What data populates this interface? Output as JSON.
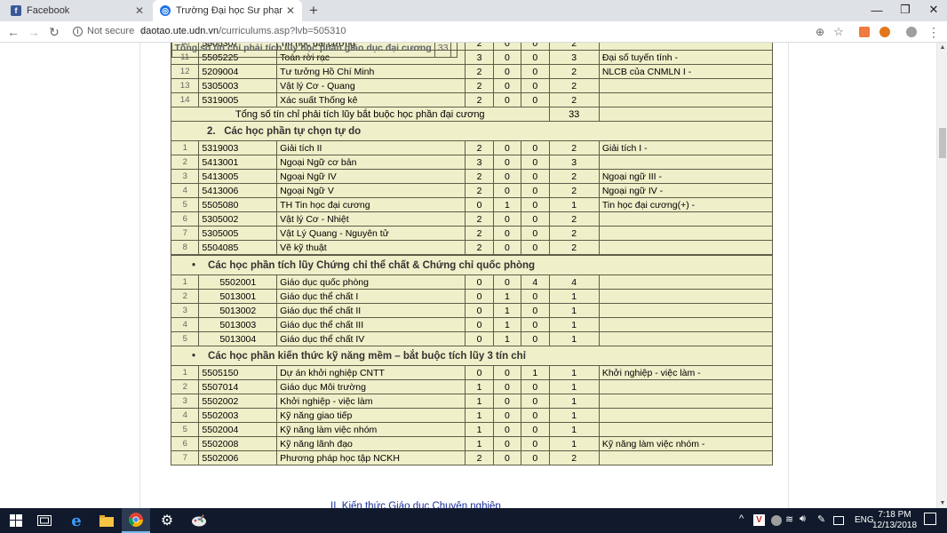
{
  "browser": {
    "tabs": [
      {
        "title": "Facebook",
        "active": false,
        "favicon": "facebook-icon",
        "color": "#3b5998"
      },
      {
        "title": "Trường Đại học Sư phạm Kỹ thuật",
        "active": true,
        "favicon": "globe-icon",
        "color": "#1a73e8"
      }
    ],
    "new_tab": "+",
    "security_label": "Not secure",
    "url_host": "daotao.ute.udn.vn",
    "url_path": "/curriculums.asp?lvb=505310",
    "window_controls": {
      "minimize": "—",
      "restore": "❐",
      "close": "✕"
    }
  },
  "page": {
    "table": {
      "group1": {
        "rows": [
          {
            "no": "11",
            "code": "5505225",
            "name": "Toán rời rạc",
            "c1": "3",
            "c2": "0",
            "c3": "0",
            "credits": "3",
            "prereq": "Đại số tuyến tính -"
          },
          {
            "no": "12",
            "code": "5209004",
            "name": "Tư tưởng Hồ Chí Minh",
            "c1": "2",
            "c2": "0",
            "c3": "0",
            "credits": "2",
            "prereq": "NLCB của CNMLN I -"
          },
          {
            "no": "13",
            "code": "5305003",
            "name": "Vật lý Cơ - Quang",
            "c1": "2",
            "c2": "0",
            "c3": "0",
            "credits": "2",
            "prereq": ""
          },
          {
            "no": "14",
            "code": "5319005",
            "name": "Xác suất Thống kê",
            "c1": "2",
            "c2": "0",
            "c3": "0",
            "credits": "2",
            "prereq": ""
          }
        ],
        "total_label": "Tổng số tín chỉ phải tích lũy bắt buộc học phần đại cương",
        "total_value": "33"
      },
      "group2": {
        "heading_num": "2.",
        "heading": "Các học phần tự chọn tự do",
        "rows": [
          {
            "no": "1",
            "code": "5319003",
            "name": "Giải tích II",
            "c1": "2",
            "c2": "0",
            "c3": "0",
            "credits": "2",
            "prereq": "Giải tích I -"
          },
          {
            "no": "2",
            "code": "5413001",
            "name": "Ngoại Ngữ cơ bản",
            "c1": "3",
            "c2": "0",
            "c3": "0",
            "credits": "3",
            "prereq": ""
          },
          {
            "no": "3",
            "code": "5413005",
            "name": "Ngoại Ngữ IV",
            "c1": "2",
            "c2": "0",
            "c3": "0",
            "credits": "2",
            "prereq": "Ngoại ngữ III -"
          },
          {
            "no": "4",
            "code": "5413006",
            "name": "Ngoại Ngữ V",
            "c1": "2",
            "c2": "0",
            "c3": "0",
            "credits": "2",
            "prereq": "Ngoại ngữ IV -"
          },
          {
            "no": "5",
            "code": "5505080",
            "name": "TH Tin học đại cương",
            "c1": "0",
            "c2": "1",
            "c3": "0",
            "credits": "1",
            "prereq": "Tin học đại cương(+) -"
          },
          {
            "no": "6",
            "code": "5305002",
            "name": "Vật lý Cơ - Nhiệt",
            "c1": "2",
            "c2": "0",
            "c3": "0",
            "credits": "2",
            "prereq": ""
          },
          {
            "no": "7",
            "code": "5305005",
            "name": "Vật Lý Quang - Nguyên tử",
            "c1": "2",
            "c2": "0",
            "c3": "0",
            "credits": "2",
            "prereq": ""
          },
          {
            "no": "8",
            "code": "5504085",
            "name": "Vẽ kỹ thuật",
            "c1": "2",
            "c2": "0",
            "c3": "0",
            "credits": "2",
            "prereq": ""
          }
        ],
        "total_label": "Tổng số tín chỉ phải tích lũy học phần giáo dục đại cương",
        "total_value": "33"
      },
      "group3": {
        "bullet": "•",
        "heading": "Các học phần tích lũy Chứng chỉ thể chất & Chứng chỉ quốc phòng",
        "rows": [
          {
            "no": "1",
            "code": "5502001",
            "name": "Giáo dục quốc phòng",
            "c1": "0",
            "c2": "0",
            "c3": "4",
            "credits": "4",
            "prereq": ""
          },
          {
            "no": "2",
            "code": "5013001",
            "name": "Giáo dục thể chất I",
            "c1": "0",
            "c2": "1",
            "c3": "0",
            "credits": "1",
            "prereq": ""
          },
          {
            "no": "3",
            "code": "5013002",
            "name": "Giáo dục thể chất II",
            "c1": "0",
            "c2": "1",
            "c3": "0",
            "credits": "1",
            "prereq": ""
          },
          {
            "no": "4",
            "code": "5013003",
            "name": "Giáo dục thể chất III",
            "c1": "0",
            "c2": "1",
            "c3": "0",
            "credits": "1",
            "prereq": ""
          },
          {
            "no": "5",
            "code": "5013004",
            "name": "Giáo dục thể chất IV",
            "c1": "0",
            "c2": "1",
            "c3": "0",
            "credits": "1",
            "prereq": ""
          }
        ]
      },
      "group4": {
        "bullet": "•",
        "heading": "Các học phần kiến thức kỹ năng mềm – bắt buộc tích lũy 3 tín chỉ",
        "rows": [
          {
            "no": "1",
            "code": "5505150",
            "name": "Dự án khởi nghiệp CNTT",
            "c1": "0",
            "c2": "0",
            "c3": "1",
            "credits": "1",
            "prereq": "Khởi nghiệp - việc làm -"
          },
          {
            "no": "2",
            "code": "5507014",
            "name": "Giáo dục Môi trường",
            "c1": "1",
            "c2": "0",
            "c3": "0",
            "credits": "1",
            "prereq": ""
          },
          {
            "no": "3",
            "code": "5502002",
            "name": "Khởi nghiệp - việc làm",
            "c1": "1",
            "c2": "0",
            "c3": "0",
            "credits": "1",
            "prereq": ""
          },
          {
            "no": "4",
            "code": "5502003",
            "name": "Kỹ năng giao tiếp",
            "c1": "1",
            "c2": "0",
            "c3": "0",
            "credits": "1",
            "prereq": ""
          },
          {
            "no": "5",
            "code": "5502004",
            "name": "Kỹ năng làm việc nhóm",
            "c1": "1",
            "c2": "0",
            "c3": "0",
            "credits": "1",
            "prereq": ""
          },
          {
            "no": "6",
            "code": "5502008",
            "name": "Kỹ năng lãnh đạo",
            "c1": "1",
            "c2": "0",
            "c3": "0",
            "credits": "1",
            "prereq": "Kỹ năng làm việc nhóm -"
          },
          {
            "no": "7",
            "code": "5502006",
            "name": "Phương pháp học tập NCKH",
            "c1": "2",
            "c2": "0",
            "c3": "0",
            "credits": "2",
            "prereq": ""
          }
        ]
      }
    },
    "next_section": "II.   Kiến thức Giáo dục Chuyên nghiệp"
  },
  "taskbar": {
    "apps": [
      "windows-start-icon",
      "task-view-icon",
      "edge-icon",
      "file-explorer-icon",
      "chrome-icon",
      "settings-icon",
      "paint-icon"
    ],
    "language": "ENG",
    "time": "7:18 PM",
    "date": "12/13/2018"
  },
  "colors": {
    "table_bg": "#efefc9",
    "border": "#5e5e4a",
    "taskbar": "#101a2c",
    "link": "#1a2f9b"
  }
}
